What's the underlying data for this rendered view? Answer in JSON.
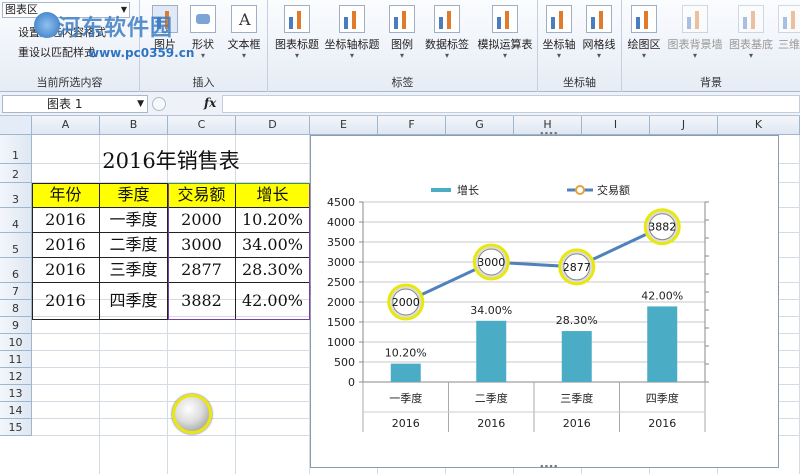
{
  "ribbon": {
    "current_selection": {
      "dropdown_value": "图表区",
      "format_selection_label": "设置所选内容格式",
      "reset_label": "重设以匹配样式",
      "group_label": "当前所选内容"
    },
    "insert": {
      "picture_label": "图片",
      "shapes_label": "形状",
      "textbox_label": "文本框",
      "group_label": "插入"
    },
    "labels": {
      "chart_title_label": "图表标题",
      "axis_title_label": "坐标轴标题",
      "legend_label": "图例",
      "data_labels_label": "数据标签",
      "data_table_label": "模拟运算表",
      "group_label": "标签"
    },
    "axes": {
      "axes_label": "坐标轴",
      "gridlines_label": "网格线",
      "group_label": "坐标轴"
    },
    "background": {
      "plot_area_label": "绘图区",
      "chart_wall_label": "图表背景墙",
      "chart_floor_label": "图表基底",
      "rotation_label": "三维旋",
      "group_label": "背景"
    },
    "watermark": {
      "site_name": "河东软件园",
      "url": "www.pc0359.cn"
    }
  },
  "formula_bar": {
    "name_box": "图表 1",
    "fx": "fx",
    "formula": ""
  },
  "grid": {
    "columns": [
      "A",
      "B",
      "C",
      "D",
      "E",
      "F",
      "G",
      "H",
      "I",
      "J",
      "K"
    ],
    "rows": [
      "1",
      "2",
      "3",
      "4",
      "5",
      "6",
      "7",
      "8",
      "9",
      "10",
      "11",
      "12",
      "13",
      "14",
      "15"
    ]
  },
  "sheet": {
    "title": "2016年销售表",
    "headers": [
      "年份",
      "季度",
      "交易额",
      "增长"
    ],
    "rows": [
      [
        "2016",
        "一季度",
        "2000",
        "10.20%"
      ],
      [
        "2016",
        "二季度",
        "3000",
        "34.00%"
      ],
      [
        "2016",
        "三季度",
        "2877",
        "28.30%"
      ],
      [
        "2016",
        "四季度",
        "3882",
        "42.00%"
      ]
    ]
  },
  "colors": {
    "bar": "#4bacc6",
    "line": "#4f81bd",
    "header_fill": "#ffff00",
    "highlight_ring": "#e8e80e"
  },
  "chart_data": {
    "type": "bar",
    "categories": [
      "一季度",
      "二季度",
      "三季度",
      "四季度"
    ],
    "year_labels": [
      "2016",
      "2016",
      "2016",
      "2016"
    ],
    "series": [
      {
        "name": "增长",
        "type": "bar",
        "values": [
          10.2,
          34.0,
          28.3,
          42.0
        ],
        "data_labels": [
          "10.20%",
          "34.00%",
          "28.30%",
          "42.00%"
        ]
      },
      {
        "name": "交易额",
        "type": "line",
        "values": [
          2000,
          3000,
          2877,
          3882
        ],
        "data_labels": [
          "2000",
          "3000",
          "2877",
          "3882"
        ]
      }
    ],
    "y_ticks": [
      "0",
      "500",
      "1000",
      "1500",
      "2000",
      "2500",
      "3000",
      "3500",
      "4000",
      "4500"
    ],
    "ylim": [
      0,
      4500
    ],
    "secondary_ylim": [
      0,
      100
    ],
    "legend_position": "top",
    "grid": true,
    "title": "",
    "xlabel": "",
    "ylabel": ""
  }
}
